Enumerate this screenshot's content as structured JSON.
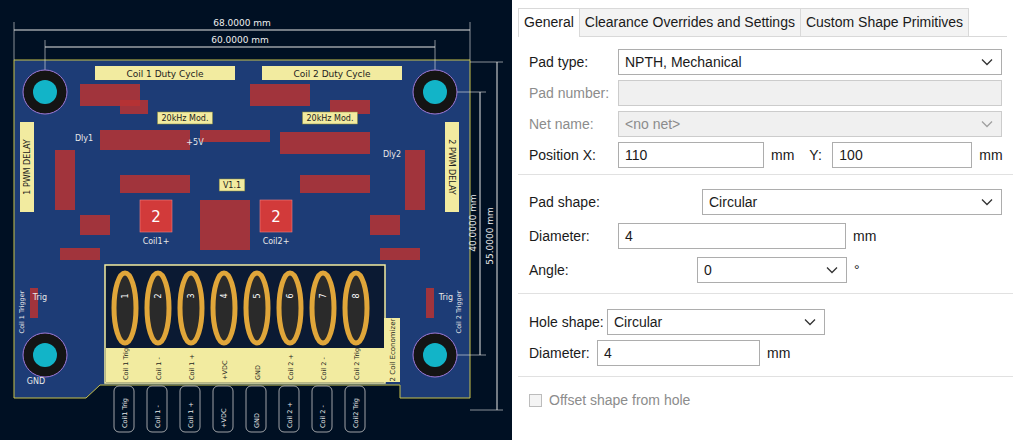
{
  "pcb": {
    "dimensions": [
      {
        "label": "68.0000 mm"
      },
      {
        "label": "60.0000 mm"
      },
      {
        "label": "40.0000 mm"
      },
      {
        "label": "55.0000 mm"
      }
    ],
    "silk_headers": [
      "Coil 1 Duty Cycle",
      "Coil 2 Duty Cycle"
    ],
    "side_labels": [
      "1 PWM DELAY",
      "2 PWM DELAY"
    ],
    "trigger_labels": [
      "Coil 1 Trigger",
      "Coil 2 Trigger"
    ],
    "small_labels": [
      "20kHz Mod.",
      "20kHz Mod.",
      "+5V",
      "V1.1",
      "Dly1",
      "Dly2",
      "GND",
      "Trig",
      "Trig"
    ],
    "drivers": [
      {
        "number": "2",
        "name": "Coil1+"
      },
      {
        "number": "2",
        "name": "Coil2+"
      }
    ],
    "connector": {
      "title": "2 Coil Economizer",
      "pins": [
        {
          "number": "1",
          "label": "Coil 1 Trig",
          "edge": "Coil1 Trig"
        },
        {
          "number": "2",
          "label": "Coil 1 -",
          "edge": "Coil 1 -"
        },
        {
          "number": "3",
          "label": "Coil 1 +",
          "edge": "Coil 1 +"
        },
        {
          "number": "4",
          "label": "+VDC",
          "edge": "+VDC"
        },
        {
          "number": "5",
          "label": "GND",
          "edge": "GND"
        },
        {
          "number": "6",
          "label": "Coil 2 +",
          "edge": "Coil 2 +"
        },
        {
          "number": "7",
          "label": "Coil 2 -",
          "edge": "Coil 2 -"
        },
        {
          "number": "8",
          "label": "Coil 2 Trig",
          "edge": "Coil2 Trig"
        }
      ]
    }
  },
  "dialog": {
    "tabs": [
      {
        "label": "General",
        "selected": true
      },
      {
        "label": "Clearance Overrides and Settings",
        "selected": false
      },
      {
        "label": "Custom Shape Primitives",
        "selected": false
      }
    ],
    "sections": [
      {
        "rows": [
          {
            "kind": "select",
            "label": "Pad type:",
            "value": "NPTH, Mechanical",
            "unit": "",
            "disabled": false
          },
          {
            "kind": "input",
            "label": "Pad number:",
            "value": "",
            "unit": "",
            "disabled": true
          },
          {
            "kind": "select",
            "label": "Net name:",
            "value": "<no net>",
            "unit": "",
            "disabled": true
          },
          {
            "kind": "position",
            "label": "Position X:",
            "value": "110",
            "unit": "mm",
            "y_label": "Y:",
            "y_value": "100",
            "y_unit": "mm",
            "disabled": false
          }
        ]
      },
      {
        "rows": [
          {
            "kind": "select",
            "label": "Pad shape:",
            "value": "Circular",
            "unit": "",
            "disabled": false
          },
          {
            "kind": "input",
            "label": "Diameter:",
            "value": "4",
            "unit": "mm",
            "disabled": false
          },
          {
            "kind": "select",
            "label": "Angle:",
            "value": "0",
            "unit": "°",
            "disabled": false
          }
        ]
      },
      {
        "rows": [
          {
            "kind": "select",
            "label": "Hole shape:",
            "value": "Circular",
            "unit": "",
            "disabled": false
          },
          {
            "kind": "input",
            "label": "Diameter:",
            "value": "4",
            "unit": "mm",
            "disabled": false
          }
        ]
      }
    ],
    "checkbox": {
      "label": "Offset shape from hole",
      "checked": false,
      "disabled": true
    }
  }
}
